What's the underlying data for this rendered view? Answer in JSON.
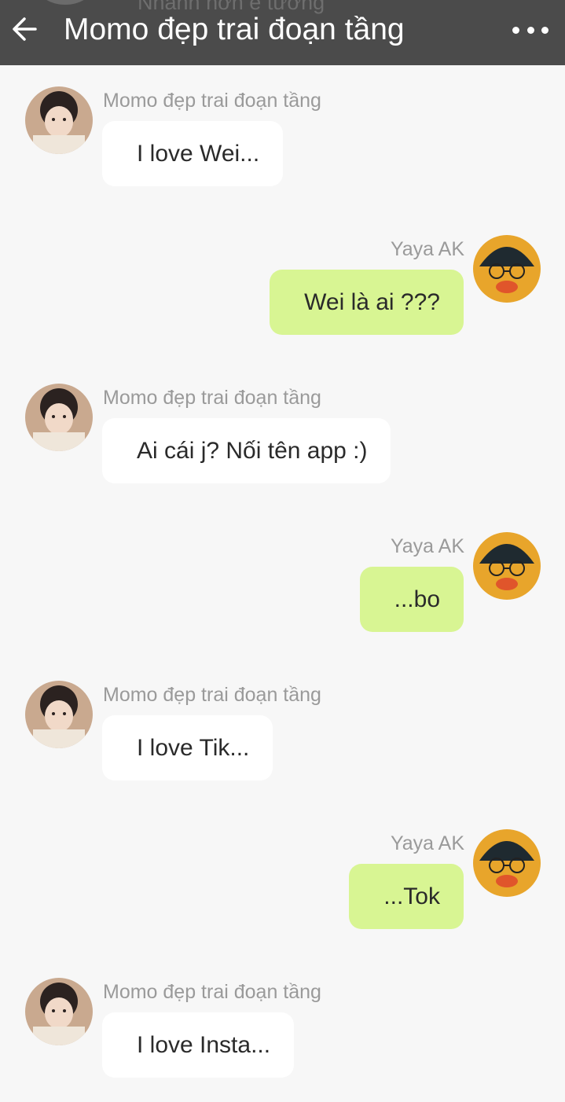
{
  "header": {
    "title": "Momo đẹp trai đoạn tầng",
    "ghost_text": "Nhanh hơn e tưởng"
  },
  "messages": [
    {
      "direction": "in",
      "sender": "Momo đẹp trai đoạn tầng",
      "text": "I love Wei..."
    },
    {
      "direction": "out",
      "sender": "Yaya AK",
      "text": "Wei là ai ???"
    },
    {
      "direction": "in",
      "sender": "Momo đẹp trai đoạn tầng",
      "text": "Ai cái j? Nối tên app :)"
    },
    {
      "direction": "out",
      "sender": "Yaya AK",
      "text": "...bo"
    },
    {
      "direction": "in",
      "sender": "Momo đẹp trai đoạn tầng",
      "text": "I love Tik..."
    },
    {
      "direction": "out",
      "sender": "Yaya AK",
      "text": "...Tok"
    },
    {
      "direction": "in",
      "sender": "Momo đẹp trai đoạn tầng",
      "text": "I love Insta..."
    }
  ],
  "icons": {
    "back": "arrow-left-icon",
    "more": "more-horizontal-icon"
  },
  "colors": {
    "header_bg": "#4b4b4b",
    "page_bg": "#f7f7f7",
    "incoming_bubble": "#ffffff",
    "outgoing_bubble": "#d8f593",
    "sender_text": "#9a9a9a"
  }
}
